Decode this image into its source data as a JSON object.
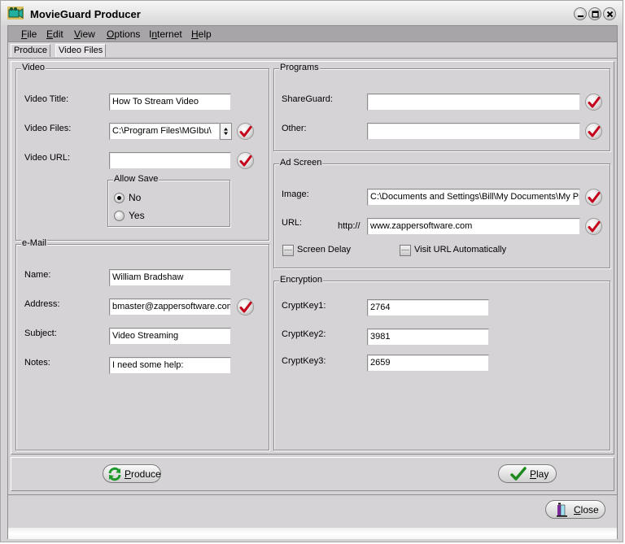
{
  "window": {
    "title": "MovieGuard Producer",
    "controls": [
      "minimize",
      "maximize",
      "close"
    ]
  },
  "menu": {
    "items": [
      {
        "label": "File",
        "accel": "F"
      },
      {
        "label": "Edit",
        "accel": "E"
      },
      {
        "label": "View",
        "accel": "V"
      },
      {
        "label": "Options",
        "accel": "O"
      },
      {
        "label": "Internet",
        "accel": "n"
      },
      {
        "label": "Help",
        "accel": "H"
      }
    ]
  },
  "tabs": [
    {
      "label": "Produce",
      "active": true
    },
    {
      "label": "Video Files",
      "active": false
    }
  ],
  "video": {
    "group_title": "Video",
    "title_label": "Video Title:",
    "title_value": "How To Stream Video",
    "files_label": "Video Files:",
    "files_value": "C:\\Program Files\\MGIbu\\",
    "url_label": "Video URL:",
    "url_value": "",
    "allow_save": {
      "group_title": "Allow Save",
      "options": [
        "No",
        "Yes"
      ],
      "selected": "No"
    }
  },
  "email": {
    "group_title": "e-Mail",
    "name_label": "Name:",
    "name_value": "William Bradshaw",
    "address_label": "Address:",
    "address_value": "bmaster@zappersoftware.com",
    "subject_label": "Subject:",
    "subject_value": "Video Streaming",
    "notes_label": "Notes:",
    "notes_value": "I need some help:"
  },
  "programs": {
    "group_title": "Programs",
    "shareguard_label": "ShareGuard:",
    "shareguard_value": "",
    "other_label": "Other:",
    "other_value": ""
  },
  "ad_screen": {
    "group_title": "Ad Screen",
    "image_label": "Image:",
    "image_value": "C:\\Documents and Settings\\Bill\\My Documents\\My Pi",
    "url_label": "URL:",
    "url_prefix": "http://",
    "url_value": "www.zappersoftware.com",
    "screen_delay_label": "Screen Delay",
    "screen_delay_checked": false,
    "visit_url_label": "Visit URL Automatically",
    "visit_url_checked": false
  },
  "encryption": {
    "group_title": "Encryption",
    "key1_label": "CryptKey1:",
    "key1_value": "2764",
    "key2_label": "CryptKey2:",
    "key2_value": "3981",
    "key3_label": "CryptKey3:",
    "key3_value": "2659"
  },
  "buttons": {
    "produce": "Produce",
    "play": "Play",
    "close": "Close"
  },
  "colors": {
    "check_mark": "#c4001a",
    "produce_icon": "#1e9a2a",
    "play_icon": "#1e8a1e",
    "close_icon": "#7a2a9a"
  }
}
